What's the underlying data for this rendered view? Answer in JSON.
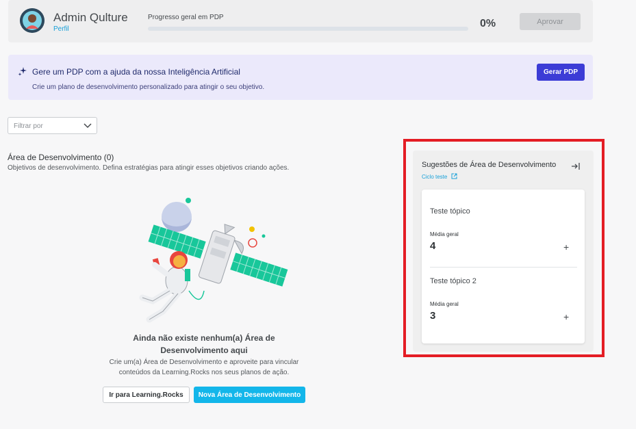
{
  "header": {
    "user_name": "Admin Qulture",
    "profile_link": "Perfil",
    "progress_label": "Progresso geral em PDP",
    "progress_value": 0,
    "progress_text": "0%",
    "approve_label": "Aprovar"
  },
  "ai_banner": {
    "title": "Gere um PDP com a ajuda da nossa Inteligência Artificial",
    "subtitle": "Crie um plano de desenvolvimento personalizado para atingir o seu objetivo.",
    "button_label": "Gerar PDP"
  },
  "filter": {
    "placeholder": "Filtrar por"
  },
  "dev_area": {
    "title": "Área de Desenvolvimento (0)",
    "description": "Objetivos de desenvolvimento. Defina estratégias para atingir esses objetivos criando ações.",
    "empty_title": "Ainda não existe nenhum(a) Área de Desenvolvimento aqui",
    "empty_description": "Crie um(a) Área de Desenvolvimento e aproveite para vincular conteúdos da Learning.Rocks nos seus planos de ação.",
    "learning_button": "Ir para Learning.Rocks",
    "new_button": "Nova Área de Desenvolvimento"
  },
  "suggestions": {
    "title": "Sugestões de Área de Desenvolvimento",
    "cycle_link": "Ciclo teste",
    "topics": [
      {
        "name": "Teste tópico",
        "avg_label": "Média geral",
        "avg_value": "4"
      },
      {
        "name": "Teste tópico 2",
        "avg_label": "Média geral",
        "avg_value": "3"
      }
    ]
  },
  "colors": {
    "accent": "#18a0d8",
    "primary_button": "#13b6ea",
    "ai_button": "#3c3cd6",
    "highlight_frame": "#e41d25"
  }
}
